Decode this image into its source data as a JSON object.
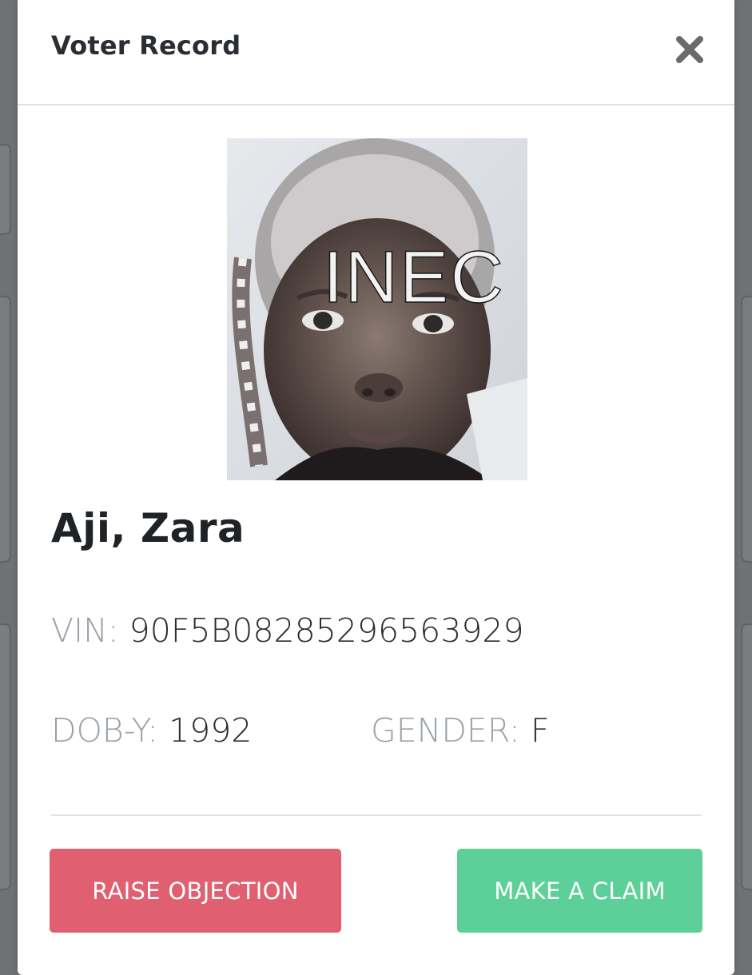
{
  "modal": {
    "title": "Voter Record",
    "close_icon": "close-icon"
  },
  "photo": {
    "watermark": "INEC"
  },
  "voter": {
    "name": "Aji, Zara",
    "vin_label": "VIN:",
    "vin": "90F5B08285296563929",
    "dob_label": "DOB-Y:",
    "dob": "1992",
    "gender_label": "GENDER:",
    "gender": "F"
  },
  "actions": {
    "objection_label": "RAISE OBJECTION",
    "claim_label": "MAKE A CLAIM"
  },
  "colors": {
    "objection": "#e05f70",
    "claim": "#5dcf98",
    "label_gray": "#9aa1a8",
    "text_dark": "#2a2d32"
  }
}
